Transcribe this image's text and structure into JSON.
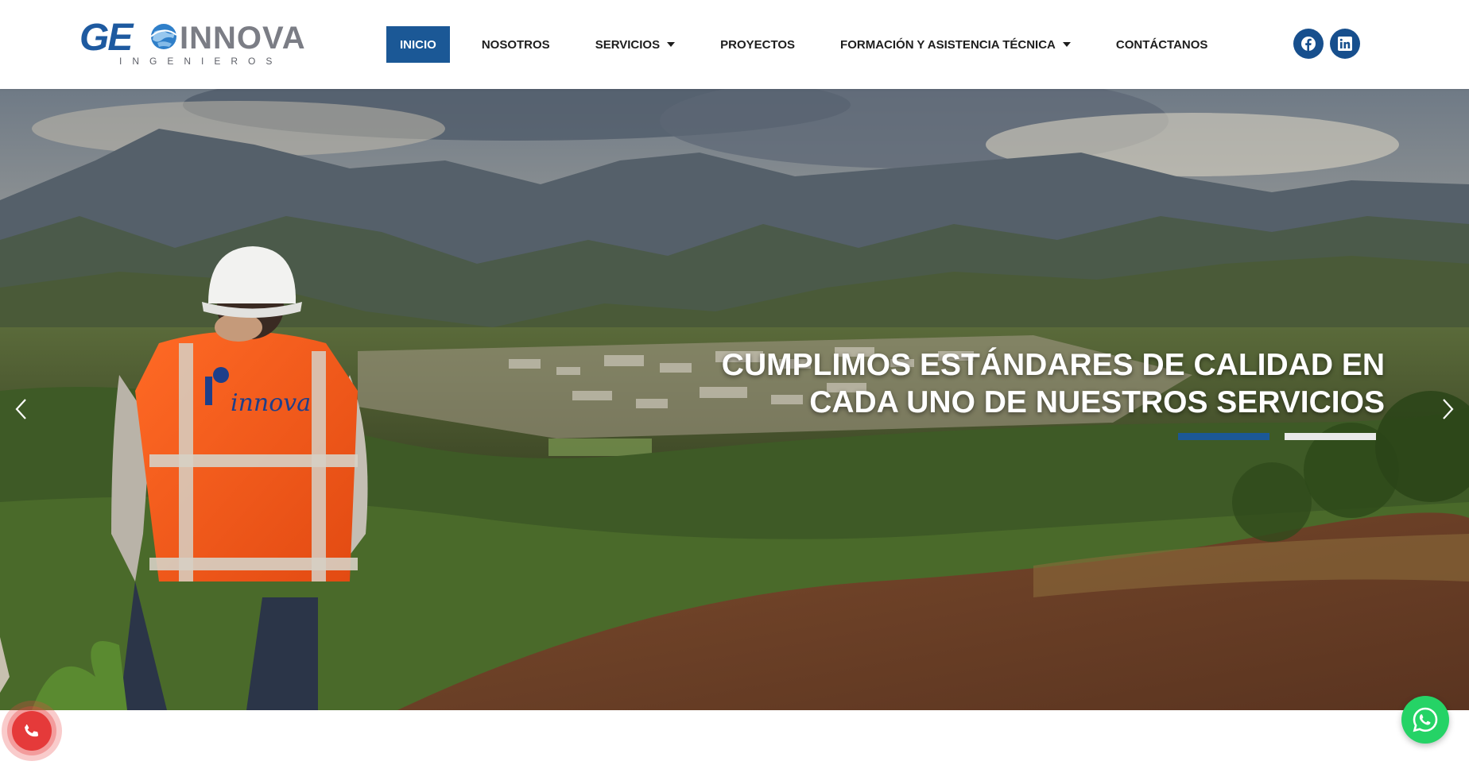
{
  "brand": {
    "logo_main_left": "GE",
    "logo_main_right": "INNOVA",
    "logo_sub": "INGENIEROS",
    "primary_color": "#1b5896",
    "logo_gray": "#7b7d85"
  },
  "nav": {
    "items": [
      {
        "label": "INICIO",
        "active": true,
        "has_dropdown": false
      },
      {
        "label": "NOSOTROS",
        "active": false,
        "has_dropdown": false
      },
      {
        "label": "SERVICIOS",
        "active": false,
        "has_dropdown": true
      },
      {
        "label": "PROYECTOS",
        "active": false,
        "has_dropdown": false
      },
      {
        "label": "FORMACIÓN Y ASISTENCIA TÉCNICA",
        "active": false,
        "has_dropdown": true
      },
      {
        "label": "CONTÁCTANOS",
        "active": false,
        "has_dropdown": false
      }
    ]
  },
  "social": {
    "icons": [
      "facebook-icon",
      "linkedin-icon"
    ]
  },
  "hero": {
    "title_line1": "CUMPLIMOS ESTÁNDARES DE CALIDAD EN",
    "title_line2": "CADA UNO DE NUESTROS SERVICIOS",
    "vest_text": "innova",
    "slides_total": 2,
    "active_slide": 1,
    "prev_icon": "chevron-left-icon",
    "next_icon": "chevron-right-icon"
  },
  "floating": {
    "call_icon": "phone-icon",
    "call_color": "#e53a3a",
    "whatsapp_icon": "whatsapp-icon",
    "whatsapp_color": "#25d366"
  }
}
